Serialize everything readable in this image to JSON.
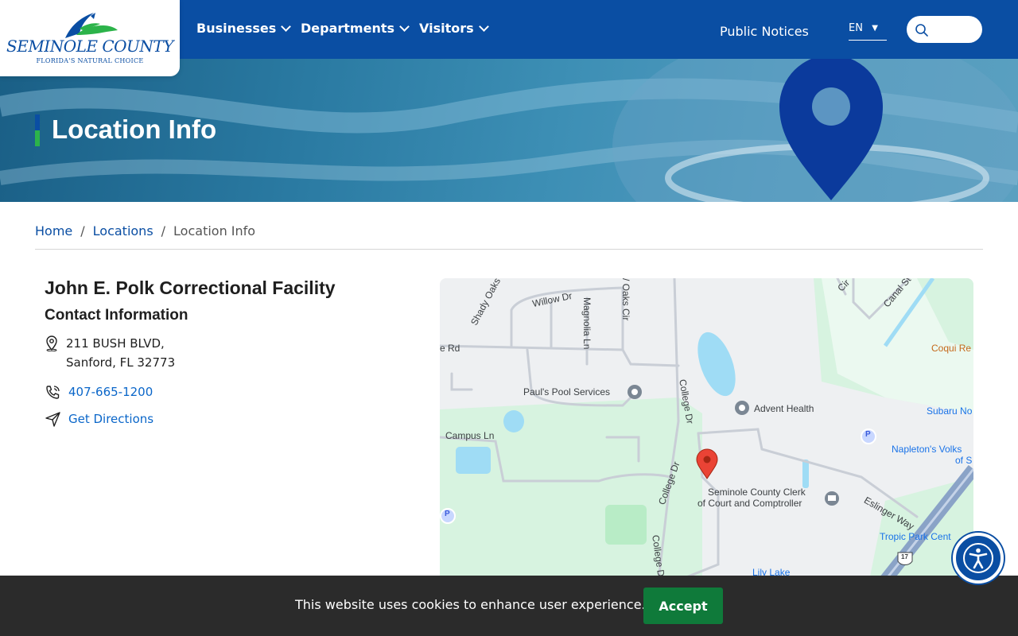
{
  "header": {
    "logo_name": "SEMINOLE COUNTY",
    "logo_tagline": "FLORIDA'S NATURAL CHOICE",
    "nav": [
      {
        "label": "Businesses"
      },
      {
        "label": "Departments"
      },
      {
        "label": "Visitors"
      }
    ],
    "public_notices": "Public Notices",
    "language": "EN"
  },
  "hero": {
    "title": "Location Info"
  },
  "breadcrumb": {
    "home": "Home",
    "locations": "Locations",
    "current": "Location Info",
    "separator": "/"
  },
  "location": {
    "name": "John E. Polk Correctional Facility",
    "contact_heading": "Contact Information",
    "address_line1": "211 BUSH BLVD,",
    "address_line2": "Sanford, FL 32773",
    "phone": "407-665-1200",
    "directions_label": "Get Directions"
  },
  "map": {
    "labels": {
      "shady_oaks": "Shady Oaks Cir",
      "willow": "Willow Dr",
      "magnolia": "Magnolia Ln",
      "oaks_cir": "/ Oaks Cir",
      "canal": "Canal St",
      "cir": "Cir",
      "rd": "e Rd",
      "coqui": "Coqui Re",
      "pauls": "Paul's Pool Services",
      "college1": "College Dr",
      "advent": "Advent Health",
      "subaru": "Subaru No",
      "campus": "Campus Ln",
      "napleton1": "Napleton's Volks",
      "napleton2": "of S",
      "college2": "College Dr",
      "clerk1": "Seminole County Clerk",
      "clerk2": "of Court and Comptroller",
      "eslinger": "Eslinger Way",
      "college3": "College D",
      "tropic": "Tropic Park Cent",
      "lily": "Lily Lake",
      "parking": "P",
      "route": "17"
    }
  },
  "cookie": {
    "message": "This website uses cookies to enhance user experience.",
    "accept_label": "Accept"
  },
  "colors": {
    "brand_blue": "#0a4ea3",
    "brand_green": "#2cb34a",
    "link": "#0a66c9",
    "accept_green": "#0f7a3a"
  },
  "icons": [
    "location-pin-icon",
    "phone-icon",
    "send-icon",
    "search-icon",
    "chevron-down-icon",
    "accessibility-icon",
    "map-marker-icon"
  ]
}
